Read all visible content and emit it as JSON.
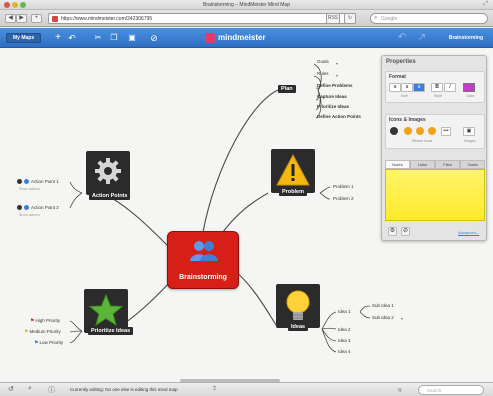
{
  "window": {
    "title": "Brainstorming – MindMeister Mind Map"
  },
  "browser": {
    "url": "https://www.mindmeister.com/242306795",
    "search_placeholder": "Google",
    "back": "◀",
    "forward": "▶",
    "add": "+",
    "reader": "RSS",
    "reload": "↻"
  },
  "toolbar": {
    "my_maps": "My Maps",
    "brand": "mindmeister",
    "brainstorming_link": "Brainstorming"
  },
  "map": {
    "central": "Brainstorming",
    "plan": {
      "label": "Plan",
      "items": [
        "Goals",
        "Rules",
        "Define Problems",
        "Capture Ideas",
        "Prioritize Ideas",
        "Define Action Points"
      ]
    },
    "problem": {
      "label": "Problem",
      "items": [
        "Problem 1",
        "Problem 2"
      ]
    },
    "ideas": {
      "label": "Ideas",
      "items": [
        "Idea 1",
        "Idea 2",
        "Idea 3",
        "Idea 4"
      ],
      "sub": [
        "Sub Idea 1",
        "Sub Idea 2"
      ]
    },
    "action_points": {
      "label": "Action Points",
      "items": [
        "Action Point 1",
        "Action Point 2"
      ],
      "notes": [
        "Show actions",
        "Show actions"
      ]
    },
    "prioritize": {
      "label": "Prioritize Ideas",
      "items": [
        "High Priority",
        "Medium Priority",
        "Low Priority"
      ],
      "flag_colors": [
        "#d8271d",
        "#e8b41c",
        "#2f6fd1"
      ]
    }
  },
  "properties": {
    "title": "Properties",
    "format": {
      "title": "Format",
      "buttons": [
        "a",
        "a",
        "a",
        "B",
        "I"
      ],
      "captions": [
        "Size",
        "Style",
        "Color"
      ],
      "color": "#c33bc9"
    },
    "icons": {
      "title": "Icons & Images",
      "captions": [
        "Recent Icons",
        "Images"
      ],
      "more": "•••"
    },
    "tabs": [
      "Notes",
      "Links",
      "Files",
      "Tasks"
    ],
    "advanced": "Advanced..."
  },
  "status": {
    "message": "Currently editing: No one else is editing this mind map",
    "zoom": "Q",
    "search_placeholder": "Search"
  }
}
